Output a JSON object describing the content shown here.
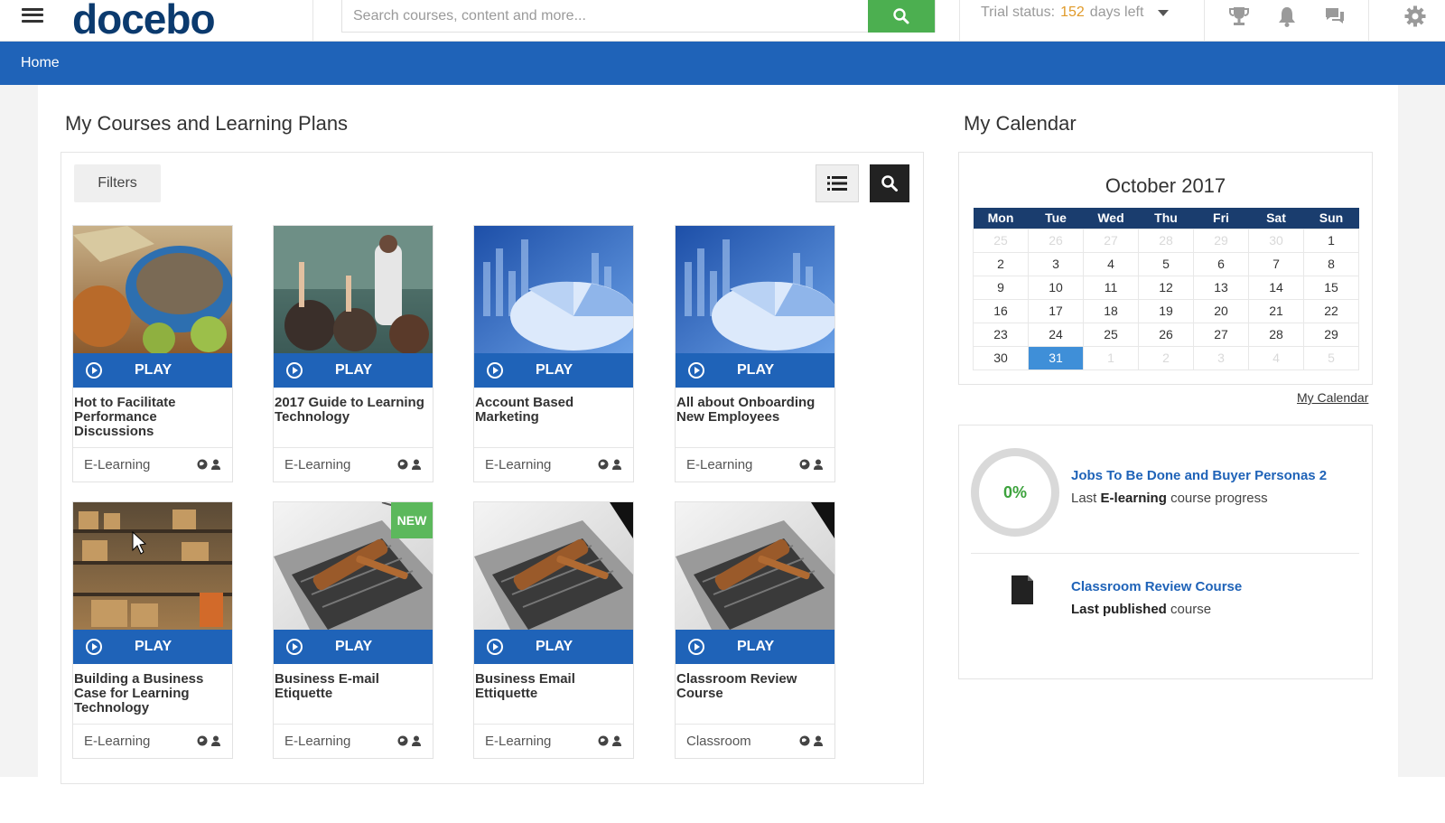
{
  "header": {
    "logo_text": "docebo",
    "logo_mark": "®",
    "search_placeholder": "Search courses, content and more...",
    "trial_prefix": "Trial status:",
    "trial_days": "152",
    "trial_suffix": "days left",
    "icons": [
      "menu-icon",
      "search-icon",
      "trophy-icon",
      "bell-icon",
      "chat-icon",
      "gear-icon"
    ]
  },
  "nav": {
    "home": "Home"
  },
  "courses": {
    "title": "My Courses and Learning Plans",
    "filters_label": "Filters",
    "play_label": "PLAY",
    "new_label": "NEW",
    "items": [
      {
        "title": "Hot to Facilitate Performance Discussions",
        "type": "E-Learning",
        "image": "food"
      },
      {
        "title": "2017 Guide to Learning Technology",
        "type": "E-Learning",
        "image": "classroom"
      },
      {
        "title": "Account Based Marketing",
        "type": "E-Learning",
        "image": "pie"
      },
      {
        "title": "All about Onboarding New Employees",
        "type": "E-Learning",
        "image": "pie"
      },
      {
        "title": "Building a Business Case for Learning Technology",
        "type": "E-Learning",
        "image": "warehouse"
      },
      {
        "title": "Business E-mail Etiquette",
        "type": "E-Learning",
        "image": "gavel",
        "is_new": true
      },
      {
        "title": "Business Email Ettiquette",
        "type": "E-Learning",
        "image": "gavel"
      },
      {
        "title": "Classroom Review Course",
        "type": "Classroom",
        "image": "gavel"
      }
    ]
  },
  "calendar": {
    "section_title": "My Calendar",
    "month": "October 2017",
    "days": [
      "Mon",
      "Tue",
      "Wed",
      "Thu",
      "Fri",
      "Sat",
      "Sun"
    ],
    "weeks": [
      [
        "25",
        "26",
        "27",
        "28",
        "29",
        "30",
        "1"
      ],
      [
        "2",
        "3",
        "4",
        "5",
        "6",
        "7",
        "8"
      ],
      [
        "9",
        "10",
        "11",
        "12",
        "13",
        "14",
        "15"
      ],
      [
        "16",
        "17",
        "18",
        "19",
        "20",
        "21",
        "22"
      ],
      [
        "23",
        "24",
        "25",
        "26",
        "27",
        "28",
        "29"
      ],
      [
        "30",
        "31",
        "1",
        "2",
        "3",
        "4",
        "5"
      ]
    ],
    "today": "31",
    "link": "My Calendar"
  },
  "recent": {
    "progress": "0%",
    "item1_title": "Jobs To Be Done and Buyer Personas 2",
    "item1_pre": "Last",
    "item1_bold": "E-learning",
    "item1_post": "course progress",
    "item2_title": "Classroom Review Course",
    "item2_bold": "Last published",
    "item2_post": "course"
  },
  "colors": {
    "brand_blue": "#1f63b8",
    "logo_navy": "#0b3a6e",
    "search_green": "#4caf50",
    "trial_orange": "#e09a2a",
    "progress_green": "#3ca23c"
  }
}
